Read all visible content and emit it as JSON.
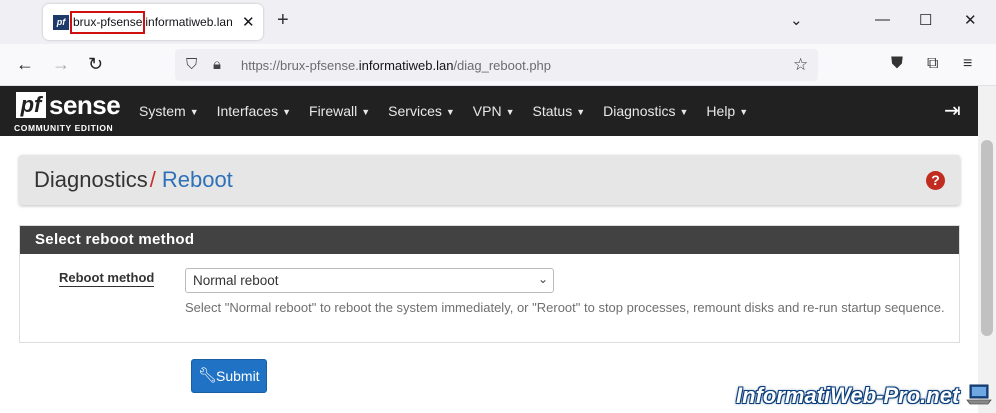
{
  "browser": {
    "tab_title_prefix": "brux-pfsense",
    "tab_title_suffix": "informatiweb.lan",
    "favicon_text": "pf",
    "url_prefix": "https://brux-pfsense.",
    "url_domain": "informatiweb.lan",
    "url_path": "/diag_reboot.php"
  },
  "brand": {
    "logo_pf": "pf",
    "logo_sense": "sense",
    "edition": "COMMUNITY EDITION"
  },
  "nav": {
    "items": [
      "System",
      "Interfaces",
      "Firewall",
      "Services",
      "VPN",
      "Status",
      "Diagnostics",
      "Help"
    ]
  },
  "breadcrumb": {
    "section": "Diagnostics",
    "separator": "/",
    "page": "Reboot",
    "help_glyph": "?"
  },
  "panel": {
    "title": "Select reboot method",
    "field_label": "Reboot method",
    "select_value": "Normal reboot",
    "help_text": "Select \"Normal reboot\" to reboot the system immediately, or \"Reroot\" to stop processes, remount disks and re-run startup sequence."
  },
  "actions": {
    "submit_label": "Submit"
  },
  "watermark": {
    "text": "InformatiWeb-Pro.net"
  },
  "colors": {
    "header_bg": "#212121",
    "panel_head_bg": "#424242",
    "accent_blue": "#2f71b8",
    "button_blue": "#1f72c4",
    "help_red": "#c12c20",
    "highlight_red": "#d01010"
  }
}
